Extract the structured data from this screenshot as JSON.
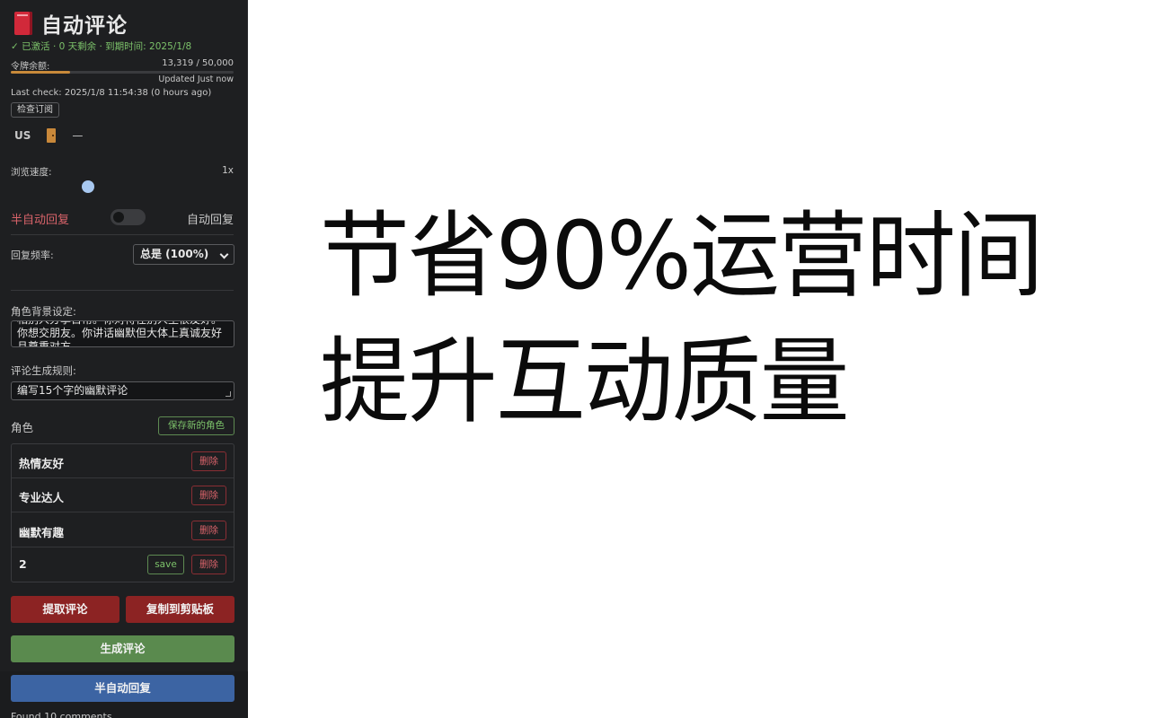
{
  "sidebar": {
    "title": "自动评论",
    "status": "✓ 已激活 · 0 天剩余 · 到期时间: 2025/1/8",
    "token": {
      "label": "令牌余额:",
      "value": "13,319 / 50,000",
      "used_fraction": 0.266,
      "updated": "Updated Just now"
    },
    "last_check": "Last check: 2025/1/8 11:54:38 (0 hours ago)",
    "check_button": "检查订阅",
    "region": {
      "code": "US",
      "dash": "—"
    },
    "speed": {
      "label": "浏览速度:",
      "value": "1x"
    },
    "mode": {
      "semi_label": "半自动回复",
      "auto_label": "自动回复",
      "toggle_on": false
    },
    "frequency": {
      "label": "回复频率:",
      "selected": "总是 (100%)"
    },
    "role_background": {
      "label": "角色背景设定:",
      "text": "相别人分享日常。你对待任别人生很友好。你想交朋友。你讲话幽默但大体上真诚友好且尊重对方"
    },
    "comment_rule": {
      "label": "评论生成规则:",
      "text": "编写15个字的幽默评论"
    },
    "roles": {
      "label": "角色",
      "save_new": "保存新的角色",
      "items": [
        {
          "name": "热情友好",
          "delete": "删除"
        },
        {
          "name": "专业达人",
          "delete": "删除"
        },
        {
          "name": "幽默有趣",
          "delete": "删除"
        },
        {
          "name": "2",
          "save": "save",
          "delete": "删除"
        }
      ]
    },
    "buttons": {
      "extract": "提取评论",
      "copy": "复制到剪贴板",
      "generate": "生成评论",
      "semi_auto": "半自动回复"
    },
    "found": "Found 10 comments"
  },
  "main": {
    "headline_1": "节省90%运营时间",
    "headline_2": "提升互动质量"
  },
  "colors": {
    "sidebar_bg": "#1e1f21",
    "accent_red": "#8c2323",
    "accent_green": "#5a8a4e",
    "accent_blue": "#3c64a3",
    "status_green": "#7cc26a"
  }
}
